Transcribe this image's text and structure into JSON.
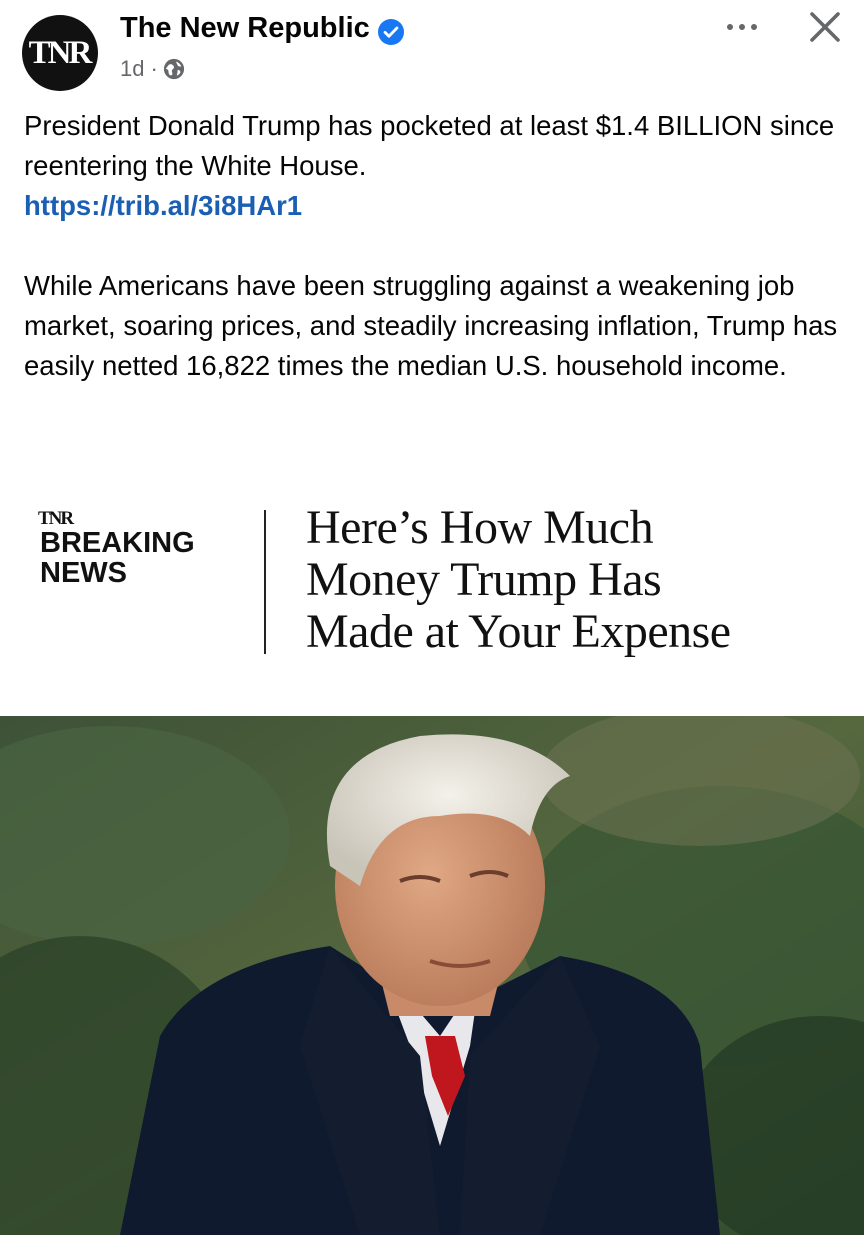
{
  "post": {
    "page_name": "The New Republic",
    "avatar_text": "TNR",
    "time": "1d",
    "separator": "·",
    "audience_icon": "globe-icon",
    "verified_icon": "verified-badge-icon",
    "menu_icon": "more-options-icon",
    "close_icon": "close-icon",
    "text_line1": "President Donald Trump has pocketed at least $1.4 BILLION since reentering the White House.",
    "link": "https://trib.al/3i8HAr1",
    "text_paragraph2": "While Americans have been struggling against a weakening job market, soaring prices, and steadily increasing inflation, Trump has easily netted 16,822 times the median U.S. household income."
  },
  "banner": {
    "logo": "TNR",
    "label_line1": "BREAKING",
    "label_line2": "NEWS",
    "headline_line1": "Here’s How Much",
    "headline_line2": "Money Trump Has",
    "headline_line3": "Made at Your Expense"
  },
  "colors": {
    "link": "#1b5fb3",
    "verified": "#1877f2",
    "meta_gray": "#65676b",
    "coat": "#0f1a2e",
    "tie": "#c0171f"
  }
}
